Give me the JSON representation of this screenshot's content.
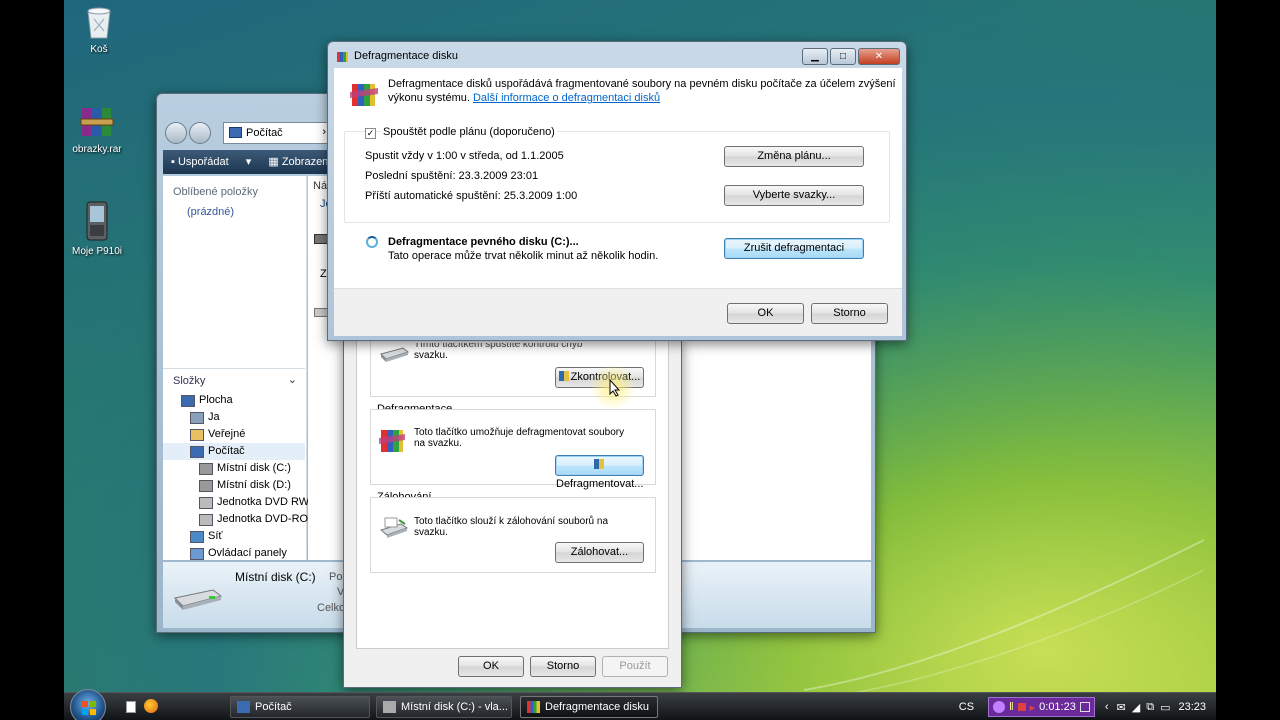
{
  "desktop": {
    "icons": [
      {
        "label": "Koš",
        "icon": "recycle-bin-icon"
      },
      {
        "label": "obrazky.rar",
        "icon": "winrar-archive-icon"
      },
      {
        "label": "Moje P910i",
        "icon": "phone-icon"
      }
    ]
  },
  "explorer": {
    "address": "Počítač",
    "toolbar": {
      "organize": "Uspořádat",
      "views": "Zobrazen"
    },
    "favorites_header": "Oblíbené položky",
    "favorites_empty": "(prázdné)",
    "folders_header": "Složky",
    "tree": [
      {
        "label": "Plocha",
        "icon": "desktop-icon",
        "indent": 0
      },
      {
        "label": "Ja",
        "icon": "user-folder-icon",
        "indent": 1
      },
      {
        "label": "Veřejné",
        "icon": "folder-icon",
        "indent": 1
      },
      {
        "label": "Počítač",
        "icon": "computer-icon",
        "indent": 1,
        "selected": true
      },
      {
        "label": "Místní disk (C:)",
        "icon": "drive-icon",
        "indent": 2
      },
      {
        "label": "Místní disk (D:)",
        "icon": "drive-icon",
        "indent": 2
      },
      {
        "label": "Jednotka DVD RW",
        "icon": "dvd-drive-icon",
        "indent": 2
      },
      {
        "label": "Jednotka DVD-RO",
        "icon": "dvd-drive-icon",
        "indent": 2
      },
      {
        "label": "Síť",
        "icon": "network-icon",
        "indent": 1
      },
      {
        "label": "Ovládací panely",
        "icon": "control-panel-icon",
        "indent": 1
      },
      {
        "label": "Koš",
        "icon": "recycle-bin-icon",
        "indent": 1
      },
      {
        "label": "Moje P910i",
        "icon": "phone-icon",
        "indent": 1
      }
    ],
    "content_partial": {
      "col_header": "Ná",
      "row1": "Je",
      "row2": "Zá"
    },
    "details": {
      "name": "Místní disk (C:)",
      "line1": "Po",
      "line2": "V",
      "line3": "Celko"
    }
  },
  "props_dialog": {
    "check_text_line1": "Tímto tlačítkem spustíte kontrolu chyb",
    "check_text_line2": "svazku.",
    "check_button": "Zkontrolovat...",
    "defrag_group_title": "Defragmentace",
    "defrag_text_line1": "Toto tlačítko umožňuje defragmentovat soubory",
    "defrag_text_line2": "na svazku.",
    "defrag_button": "Defragmentovat...",
    "backup_group_title": "Zálohování",
    "backup_text_line1": "Toto tlačítko slouží k zálohování souborů na",
    "backup_text_line2": "svazku.",
    "backup_button": "Zálohovat...",
    "ok": "OK",
    "cancel": "Storno",
    "apply": "Použít"
  },
  "defrag_dialog": {
    "title": "Defragmentace disku",
    "intro_line1": "Defragmentace disků uspořádává fragmentované soubory na pevném disku počítače za účelem zvýšení",
    "intro_line2": "výkonu systému.",
    "intro_link": "Další informace o defragmentaci disků",
    "schedule_checkbox": "Spouštět podle plánu (doporučeno)",
    "schedule_checked": true,
    "run_line": "Spustit vždy v 1:00 v středa, od 1.1.2005",
    "last_run": "Poslední spuštění: 23.3.2009 23:01",
    "next_run": "Příští automatické spuštění: 25.3.2009 1:00",
    "change_schedule_button": "Změna plánu...",
    "select_volumes_button": "Vyberte svazky...",
    "status_title": "Defragmentace pevného disku (C:)...",
    "status_sub": "Tato operace může trvat několik minut až několik hodin.",
    "cancel_defrag_button": "Zrušit defragmentaci",
    "ok": "OK",
    "cancel": "Storno"
  },
  "taskbar": {
    "tasks": [
      {
        "label": "Počítač",
        "icon": "computer-icon",
        "active": false
      },
      {
        "label": "Místní disk (C:) - vla...",
        "icon": "drive-icon",
        "active": false
      },
      {
        "label": "Defragmentace disku",
        "icon": "defrag-icon",
        "active": true
      }
    ],
    "language": "CS",
    "recorder_time": "0:01:23",
    "clock": "23:23"
  }
}
